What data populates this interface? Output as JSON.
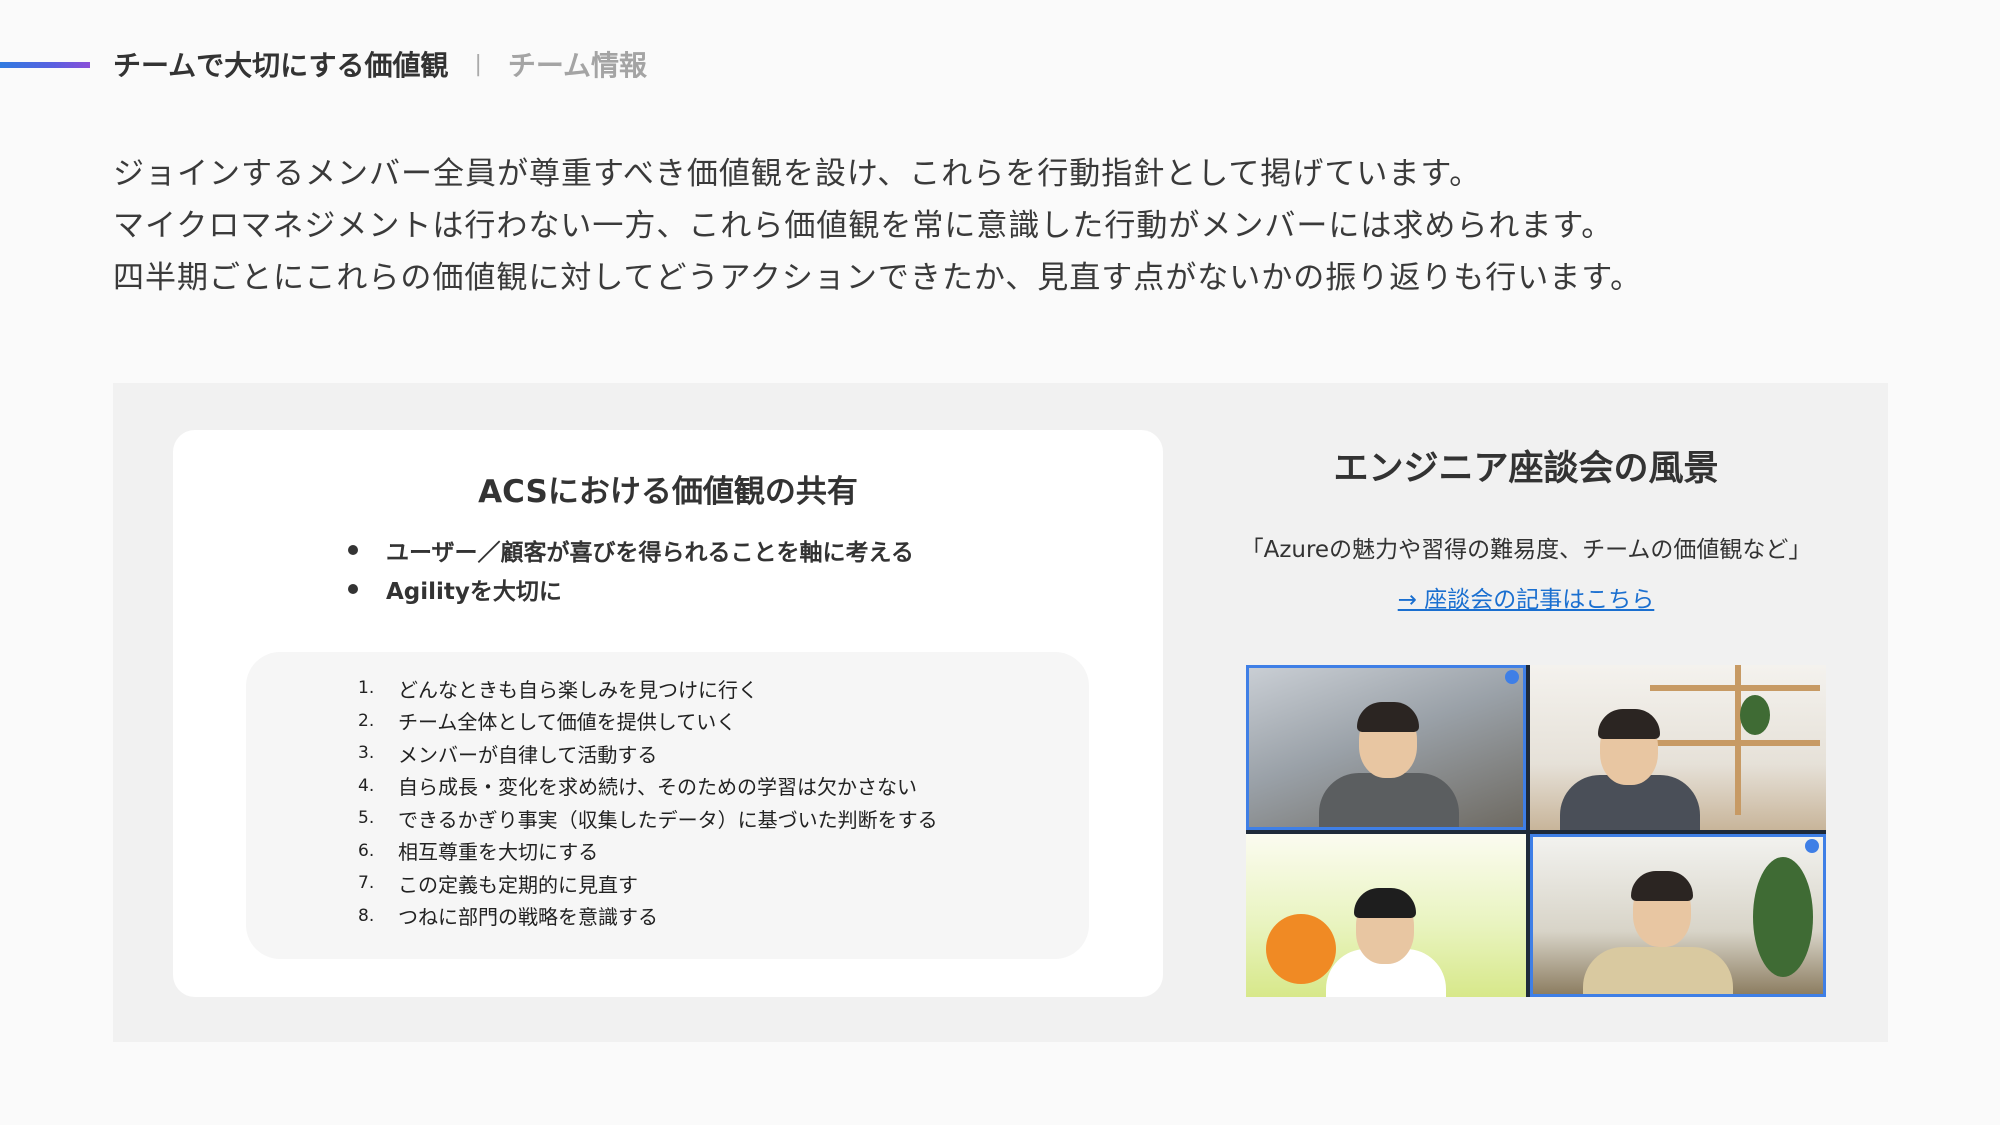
{
  "header": {
    "title": "チームで大切にする価値観",
    "separator": "|",
    "subtitle": "チーム情報"
  },
  "intro": {
    "line1": "ジョインするメンバー全員が尊重すべき価値観を設け、これらを行動指針として掲げています。",
    "line2": "マイクロマネジメントは行わない一方、これら価値観を常に意識した行動がメンバーには求められます。",
    "line3": "四半期ごとにこれらの価値観に対してどうアクションできたか、見直す点がないかの振り返りも行います。"
  },
  "card": {
    "title": "ACSにおける価値観の共有",
    "bullets": [
      "ユーザー／顧客が喜びを得られることを軸に考える",
      "Agilityを大切に"
    ],
    "values": [
      {
        "num": "1.",
        "text": "どんなときも自ら楽しみを見つけに行く"
      },
      {
        "num": "2.",
        "text": "チーム全体として価値を提供していく"
      },
      {
        "num": "3.",
        "text": "メンバーが自律して活動する"
      },
      {
        "num": "4.",
        "text": "自ら成長・変化を求め続け、そのための学習は欠かさない"
      },
      {
        "num": "5.",
        "text": "できるかぎり事実（収集したデータ）に基づいた判断をする"
      },
      {
        "num": "6.",
        "text": "相互尊重を大切にする"
      },
      {
        "num": "7.",
        "text": "この定義も定期的に見直す"
      },
      {
        "num": "8.",
        "text": "つねに部門の戦略を意識する"
      }
    ]
  },
  "right": {
    "title": "エンジニア座談会の風景",
    "quote": "「Azureの魅力や習得の難易度、チームの価値観など」",
    "link": "→ 座談会の記事はこちら"
  },
  "colors": {
    "accent_start": "#2f7be0",
    "accent_end": "#8a4fd8",
    "link": "#1a6fd0",
    "panel_bg": "#f1f1f1"
  }
}
